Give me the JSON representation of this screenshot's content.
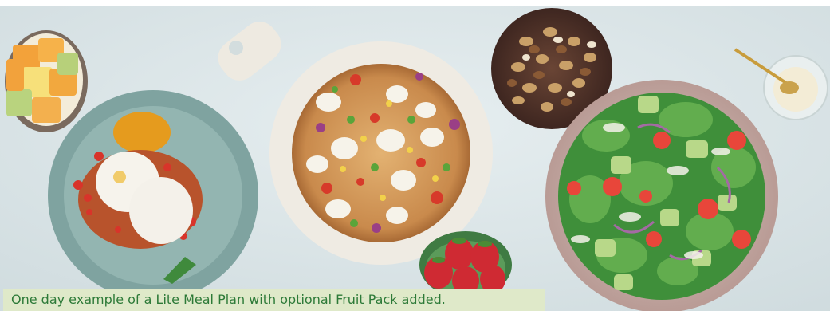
{
  "caption": "One day example of a Lite Meal Plan with optional Fruit Pack added.",
  "colors": {
    "background": "#d9e3e6",
    "caption_band": "#dfe9c9",
    "caption_text": "#2d7a38"
  }
}
